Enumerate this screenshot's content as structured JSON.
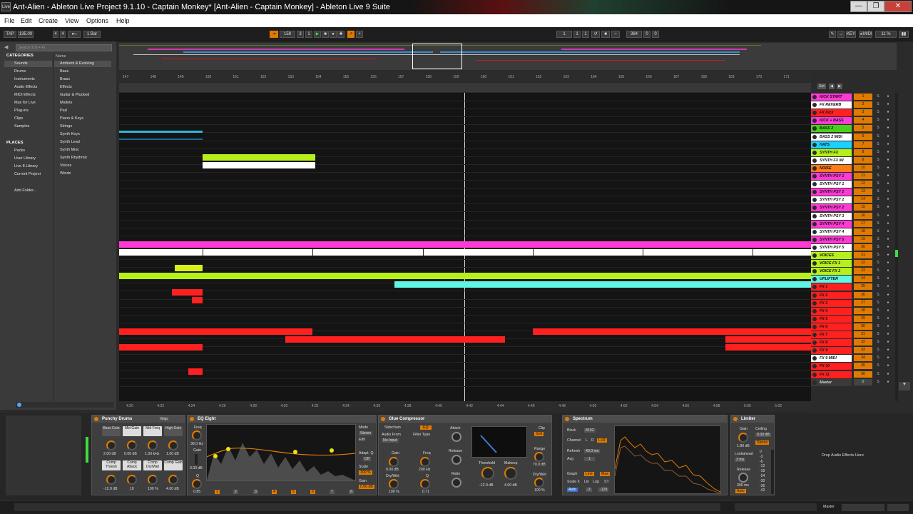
{
  "window": {
    "title": "Ant-Alien - Ableton Live Project 9.1.10 - Captain Monkey* [Ant-Alien - Captain Monkey] - Ableton Live 9 Suite",
    "logo": "Live"
  },
  "menu": [
    "File",
    "Edit",
    "Create",
    "View",
    "Options",
    "Help"
  ],
  "transport": {
    "tap": "TAP",
    "tempo": "135.00",
    "sig_num": "4",
    "sig_den": "4",
    "quant": "1 Bar",
    "pos1": "159",
    "pos2": "3",
    "pos3": "1",
    "loop1": "1",
    "loop2": "1",
    "loop3": "1",
    "len1": "384",
    "len2": "0",
    "len3": "0",
    "key": "KEY",
    "midi": "MIDI",
    "cpu": "11 %"
  },
  "browser": {
    "search_placeholder": "Search (Ctrl + F)",
    "categories_label": "CATEGORIES",
    "categories": [
      "Sounds",
      "Drums",
      "Instruments",
      "Audio Effects",
      "MIDI Effects",
      "Max for Live",
      "Plug-ins",
      "Clips",
      "Samples"
    ],
    "places_label": "PLACES",
    "places": [
      "Packs",
      "User Library",
      "Live 8 Library",
      "Current Project"
    ],
    "add_folder": "Add Folder...",
    "name_header": "Name",
    "items": [
      "Ambient & Evolving",
      "Bass",
      "Brass",
      "Effects",
      "Guitar & Plucked",
      "Mallets",
      "Pad",
      "Piano & Keys",
      "Strings",
      "Synth Keys",
      "Synth Lead",
      "Synth Misc",
      "Synth Rhythmic",
      "Voices",
      "Winds"
    ]
  },
  "ruler": [
    "147",
    "148",
    "149",
    "150",
    "151",
    "152",
    "153",
    "154",
    "155",
    "156",
    "157",
    "158",
    "159",
    "160",
    "161",
    "162",
    "163",
    "164",
    "165",
    "166",
    "167",
    "168",
    "169",
    "170",
    "171"
  ],
  "time_ruler": [
    "4:20",
    "4:22",
    "4:24",
    "4:26",
    "4:28",
    "4:30",
    "4:32",
    "4:34",
    "4:36",
    "4:38",
    "4:40",
    "4:42",
    "4:44",
    "4:46",
    "4:48",
    "4:50",
    "4:52",
    "4:54",
    "4:56",
    "4:58",
    "5:00",
    "5:02"
  ],
  "tracks": [
    {
      "name": "KICK START",
      "color": "#ff39d4",
      "num": "1"
    },
    {
      "name": "FX REVERB",
      "color": "#ffffff",
      "num": "2"
    },
    {
      "name": "FX Kick",
      "color": "#ff2020",
      "num": "3"
    },
    {
      "name": "KICK + BASS",
      "color": "#ff39d4",
      "num": "4"
    },
    {
      "name": "BASS 2",
      "color": "#47d11a",
      "num": "5"
    },
    {
      "name": "BASS 2 MIDI",
      "color": "#ffffff",
      "num": "6"
    },
    {
      "name": "HATS",
      "color": "#1ad1ff",
      "num": "7"
    },
    {
      "name": "SYNTH FX",
      "color": "#b6ef1a",
      "num": "8"
    },
    {
      "name": "SYNTH FX MI",
      "color": "#ffffff",
      "num": "9"
    },
    {
      "name": "NOISE",
      "color": "#ff7a1a",
      "num": "10"
    },
    {
      "name": "SYNTH PSY 1",
      "color": "#ff39d4",
      "num": "11"
    },
    {
      "name": "SYNTH PSY 1",
      "color": "#ffffff",
      "num": "12"
    },
    {
      "name": "SYNTH PSY 2",
      "color": "#ff39d4",
      "num": "13"
    },
    {
      "name": "SYNTH PSY 2",
      "color": "#ffffff",
      "num": "14"
    },
    {
      "name": "SYNTH PSY 2",
      "color": "#ff39d4",
      "num": "15"
    },
    {
      "name": "SYNTH PSY 3",
      "color": "#ffffff",
      "num": "16"
    },
    {
      "name": "SYNTH PSY 4",
      "color": "#ff39d4",
      "num": "17"
    },
    {
      "name": "SYNTH PSY 4",
      "color": "#ffffff",
      "num": "18"
    },
    {
      "name": "SYNTH PSY 5",
      "color": "#ff39d4",
      "num": "19"
    },
    {
      "name": "SYNTH PSY 5",
      "color": "#ffffff",
      "num": "20"
    },
    {
      "name": "VOICES",
      "color": "#b6ef1a",
      "num": "21"
    },
    {
      "name": "VOICE FX 1",
      "color": "#b6ef1a",
      "num": "22"
    },
    {
      "name": "VOICE FX 2",
      "color": "#b6ef1a",
      "num": "23"
    },
    {
      "name": "UPLIFTER",
      "color": "#5ff5e5",
      "num": "24"
    },
    {
      "name": "FX 1",
      "color": "#ff2020",
      "num": "25"
    },
    {
      "name": "FX 2",
      "color": "#ff2020",
      "num": "26"
    },
    {
      "name": "FX 3",
      "color": "#ff2020",
      "num": "27"
    },
    {
      "name": "FX 4",
      "color": "#ff2020",
      "num": "28"
    },
    {
      "name": "FX 5",
      "color": "#ff2020",
      "num": "29"
    },
    {
      "name": "FX 6",
      "color": "#ff2020",
      "num": "30"
    },
    {
      "name": "FX 7",
      "color": "#ff2020",
      "num": "31"
    },
    {
      "name": "FX 8",
      "color": "#ff2020",
      "num": "32"
    },
    {
      "name": "FX 9",
      "color": "#ff2020",
      "num": "33"
    },
    {
      "name": "FX 9 MIDI",
      "color": "#ffffff",
      "num": "34"
    },
    {
      "name": "FX 10",
      "color": "#ff2020",
      "num": "35"
    },
    {
      "name": "FX 11",
      "color": "#ff2020",
      "num": "36"
    },
    {
      "name": "Master",
      "color": "#3a3a3a",
      "num": "0"
    }
  ],
  "devices": {
    "punchy": {
      "title": "Punchy Drums",
      "map": "Map",
      "macros": [
        "Bass Gain",
        "Mid Gain",
        "Mid Freq",
        "High Gain"
      ],
      "vals1": [
        "2.00 dB",
        "0.00 dB",
        "1.50 kHz",
        "1.00 dB"
      ],
      "macros2": [
        "Comp Thresh",
        "Comp Attack",
        "Comp Dry/Wet",
        "Comp Gain"
      ],
      "vals2": [
        "-12.0 dB",
        "10",
        "100 %",
        "4.00 dB"
      ]
    },
    "eq": {
      "title": "EQ Eight",
      "freq_lbl": "Freq",
      "freq_val": "38.0 Hz",
      "gain_lbl": "Gain",
      "gain_val": "0.00 dB",
      "q_lbl": "Q",
      "q_val": "0.85",
      "mode_lbl": "Mode",
      "mode_val": "Stereo",
      "edit": "Edit",
      "adapt_lbl": "Adapt. Q",
      "adapt_val": "Off",
      "scale_lbl": "Scale",
      "scale_val": "100 %",
      "outgain_lbl": "Gain",
      "outgain_val": "0.00 dB",
      "bands": [
        "1",
        "2",
        "3",
        "4",
        "5",
        "6",
        "7",
        "8"
      ]
    },
    "glue": {
      "title": "Glue Compressor",
      "sidechain": "Sidechain",
      "eq_btn": "EQ",
      "audio_from": "Audio From",
      "no_input": "No Input",
      "filter_type": "Filter Type",
      "gain_lbl": "Gain",
      "gain_val": "0.00 dB",
      "freq_lbl": "Freq",
      "freq_val": "200 Hz",
      "drywet_lbl": "Dry/Wet",
      "drywet_val": "100 %",
      "q_lbl": "Q",
      "q_val": "0.71",
      "attack": "Attack",
      "release": "Release",
      "ratio": "Ratio",
      "threshold": "Threshold",
      "threshold_val": "-12.0 dB",
      "makeup": "Makeup",
      "makeup_val": "4.00 dB",
      "clip": "Clip",
      "soft": "Soft",
      "range": "Range",
      "range_val": "70.0 dB",
      "dw2_lbl": "Dry/Wet",
      "dw2_val": "100 %"
    },
    "spectrum": {
      "title": "Spectrum",
      "block": "Block",
      "block_val": "8192",
      "channel": "Channel",
      "ch_l": "L",
      "ch_r": "R",
      "ch_lr": "L+R",
      "refresh": "Refresh",
      "refresh_val": "40.0 ms",
      "avg": "Avg",
      "avg_val": "1",
      "graph": "Graph",
      "line": "Line",
      "max": "Max",
      "scale_x": "Scale X",
      "lin": "Lin",
      "log": "Log",
      "st": "ST",
      "auto": "Auto",
      "range1": "-3",
      "range2": "-129"
    },
    "limiter": {
      "title": "Limiter",
      "gain_lbl": "Gain",
      "gain_val": "1.80 dB",
      "ceiling_lbl": "Ceiling",
      "ceiling_val": "0.00 dB",
      "stereo": "Stereo",
      "lookahead": "Lookahead",
      "lookahead_val": "3 ms",
      "release_lbl": "Release",
      "release_val": "300 ms",
      "auto": "Auto",
      "scale": [
        "0",
        "-3",
        "-6",
        "-12",
        "-18",
        "-24",
        "-30",
        "-36",
        "-42"
      ]
    },
    "drop": "Drop Audio Effects Here"
  },
  "status": {
    "master": "Master"
  }
}
